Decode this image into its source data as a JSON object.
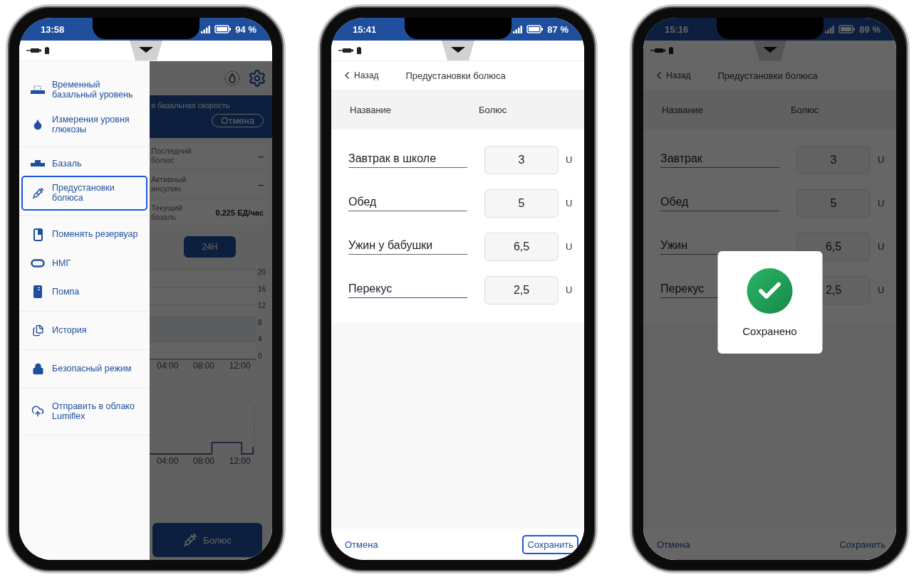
{
  "phones": [
    {
      "kind": "menu",
      "status": {
        "time": "13:58",
        "battery": "94 %"
      },
      "home": {
        "banner_text": "я базальная скорость",
        "banner_button": "Отмена",
        "stats": [
          {
            "label": "Последний болюс",
            "value": "--"
          },
          {
            "label": "Активный инсулин",
            "value": "--"
          },
          {
            "label": "Текущий базаль",
            "value": "0,225 ЕД/час"
          }
        ],
        "range_button": "24H",
        "glucose_chart": {
          "y_ticks": [
            "20",
            "16",
            "12",
            "8",
            "4",
            "0"
          ],
          "x_ticks": [
            "04:00",
            "08:00",
            "12:00"
          ]
        },
        "basal_chart": {
          "x_ticks": [
            "04:00",
            "08:00",
            "12:00"
          ]
        },
        "bolus_button": "Болюс"
      },
      "drawer": {
        "groups": [
          {
            "items": [
              {
                "label": "Временный базальный уровень",
                "selected": false
              },
              {
                "label": "Измерения уровня глюкозы",
                "selected": false
              }
            ]
          },
          {
            "items": [
              {
                "label": "Базаль",
                "selected": false
              },
              {
                "label": "Предустановки болюса",
                "selected": true
              }
            ]
          },
          {
            "items": [
              {
                "label": "Поменять резервуар",
                "selected": false
              },
              {
                "label": "НМГ",
                "selected": false
              },
              {
                "label": "Помпа",
                "selected": false
              }
            ]
          },
          {
            "items": [
              {
                "label": "История",
                "selected": false
              }
            ]
          },
          {
            "items": [
              {
                "label": "Безопасный режим",
                "selected": false
              }
            ]
          },
          {
            "items": [
              {
                "label": "Отправить в облако Lumiflex",
                "selected": false
              }
            ]
          }
        ]
      }
    },
    {
      "kind": "presets",
      "dimmed": false,
      "status": {
        "time": "15:41",
        "battery": "87 %"
      },
      "back": "Назад",
      "title": "Предустановки болюса",
      "columns": [
        "Название",
        "Болюс"
      ],
      "presets": [
        {
          "name": "Завтрак в школе",
          "bolus": "3",
          "unit": "U",
          "focused": false
        },
        {
          "name": "Обед",
          "bolus": "5",
          "unit": "U",
          "focused": false
        },
        {
          "name": "Ужин у бабушки",
          "bolus": "6,5",
          "unit": "U",
          "focused": false
        },
        {
          "name": "Перекус",
          "bolus": "2,5",
          "unit": "U",
          "focused": true
        }
      ],
      "cancel": {
        "label": "Отмена",
        "highlighted": false
      },
      "save": {
        "label": "Сохранить",
        "highlighted": true
      }
    },
    {
      "kind": "presets",
      "dimmed": true,
      "status": {
        "time": "15:16",
        "battery": "89 %"
      },
      "back": "Назад",
      "title": "Предустановки болюса",
      "columns": [
        "Название",
        "Болюс"
      ],
      "presets": [
        {
          "name": "Завтрак",
          "bolus": "3",
          "unit": "U",
          "focused": false
        },
        {
          "name": "Обед",
          "bolus": "5",
          "unit": "U",
          "focused": false
        },
        {
          "name": "Ужин",
          "bolus": "6,5",
          "unit": "U",
          "focused": false
        },
        {
          "name": "Перекус",
          "bolus": "2,5",
          "unit": "U",
          "focused": false
        }
      ],
      "cancel": {
        "label": "Отмена",
        "highlighted": false
      },
      "save": {
        "label": "Сохранить",
        "highlighted": false
      },
      "toast": {
        "text": "Сохранено"
      }
    }
  ]
}
